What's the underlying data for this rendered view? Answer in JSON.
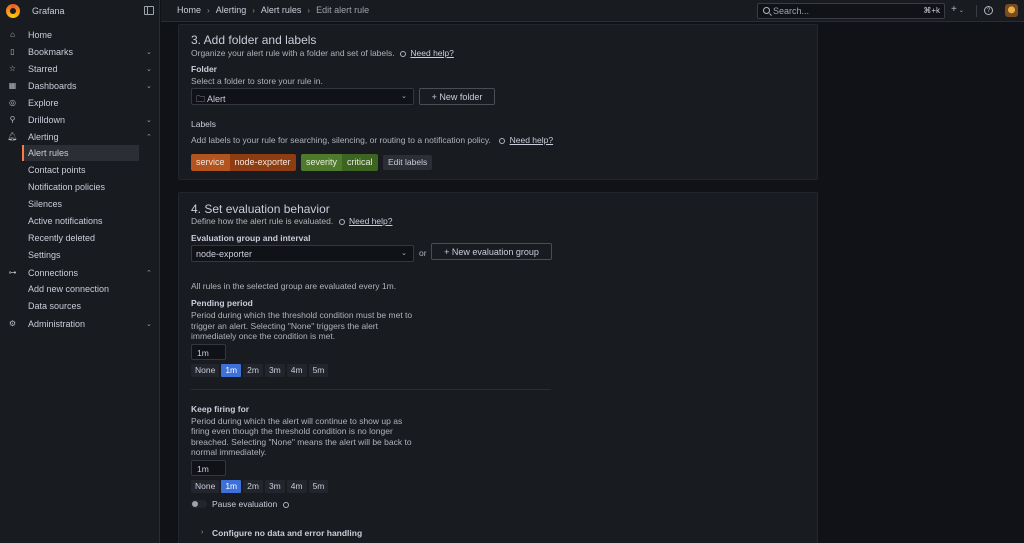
{
  "app": {
    "name": "Grafana"
  },
  "sidebar": {
    "items": [
      {
        "label": "Home",
        "icon": "home-icon",
        "chevron": ""
      },
      {
        "label": "Bookmarks",
        "icon": "bookmark-icon",
        "chevron": "⌄"
      },
      {
        "label": "Starred",
        "icon": "star-icon",
        "chevron": "⌄"
      },
      {
        "label": "Dashboards",
        "icon": "dashboards-icon",
        "chevron": "⌄"
      },
      {
        "label": "Explore",
        "icon": "compass-icon",
        "chevron": ""
      },
      {
        "label": "Drilldown",
        "icon": "drilldown-icon",
        "chevron": "⌄"
      },
      {
        "label": "Alerting",
        "icon": "bell-icon",
        "chevron": "⌃"
      }
    ],
    "alerting_children": [
      "Alert rules",
      "Contact points",
      "Notification policies",
      "Silences",
      "Active notifications",
      "Recently deleted",
      "Settings"
    ],
    "connections": {
      "label": "Connections",
      "icon": "connections-icon",
      "chevron": "⌃"
    },
    "connections_children": [
      "Add new connection",
      "Data sources"
    ],
    "administration": {
      "label": "Administration",
      "icon": "gear-icon",
      "chevron": "⌄"
    }
  },
  "breadcrumb": [
    "Home",
    "Alerting",
    "Alert rules",
    "Edit alert rule"
  ],
  "search": {
    "placeholder": "Search...",
    "shortcut": "⌘+k"
  },
  "topbar": {
    "plus": "+",
    "caret": "⌄",
    "help": "?"
  },
  "section3": {
    "title": "3. Add folder and labels",
    "description": "Organize your alert rule with a folder and set of labels.",
    "help_link": "Need help?",
    "folder_label": "Folder",
    "folder_desc": "Select a folder to store your rule in.",
    "folder_value": "Alert",
    "new_folder": "New folder",
    "labels_label": "Labels",
    "labels_desc": "Add labels to your rule for searching, silencing, or routing to a notification policy.",
    "labels_help": "Need help?",
    "labels": [
      {
        "key": "service",
        "value": "node-exporter"
      },
      {
        "key": "severity",
        "value": "critical"
      }
    ],
    "edit_labels": "Edit labels"
  },
  "section4": {
    "title": "4. Set evaluation behavior",
    "description": "Define how the alert rule is evaluated.",
    "help_link": "Need help?",
    "group_label": "Evaluation group and interval",
    "group_value": "node-exporter",
    "or_text": "or",
    "new_group": "New evaluation group",
    "group_info": "All rules in the selected group are evaluated every 1m.",
    "pending_label": "Pending period",
    "pending_desc_1": "Period during which the threshold condition must be met to",
    "pending_desc_2": "trigger an alert. Selecting \"None\" triggers the alert",
    "pending_desc_3": "immediately once the condition is met.",
    "pending_value": "1m",
    "pending_options": [
      "None",
      "1m",
      "2m",
      "3m",
      "4m",
      "5m"
    ],
    "keep_label": "Keep firing for",
    "keep_desc_1": "Period during which the alert will continue to show up as",
    "keep_desc_2": "firing even though the threshold condition is no longer",
    "keep_desc_3": "breached. Selecting \"None\" means the alert will be back to",
    "keep_desc_4": "normal immediately.",
    "keep_value": "1m",
    "keep_options": [
      "None",
      "1m",
      "2m",
      "3m",
      "4m",
      "5m"
    ],
    "pause_label": "Pause evaluation",
    "configure_label": "Configure no data and error handling"
  }
}
